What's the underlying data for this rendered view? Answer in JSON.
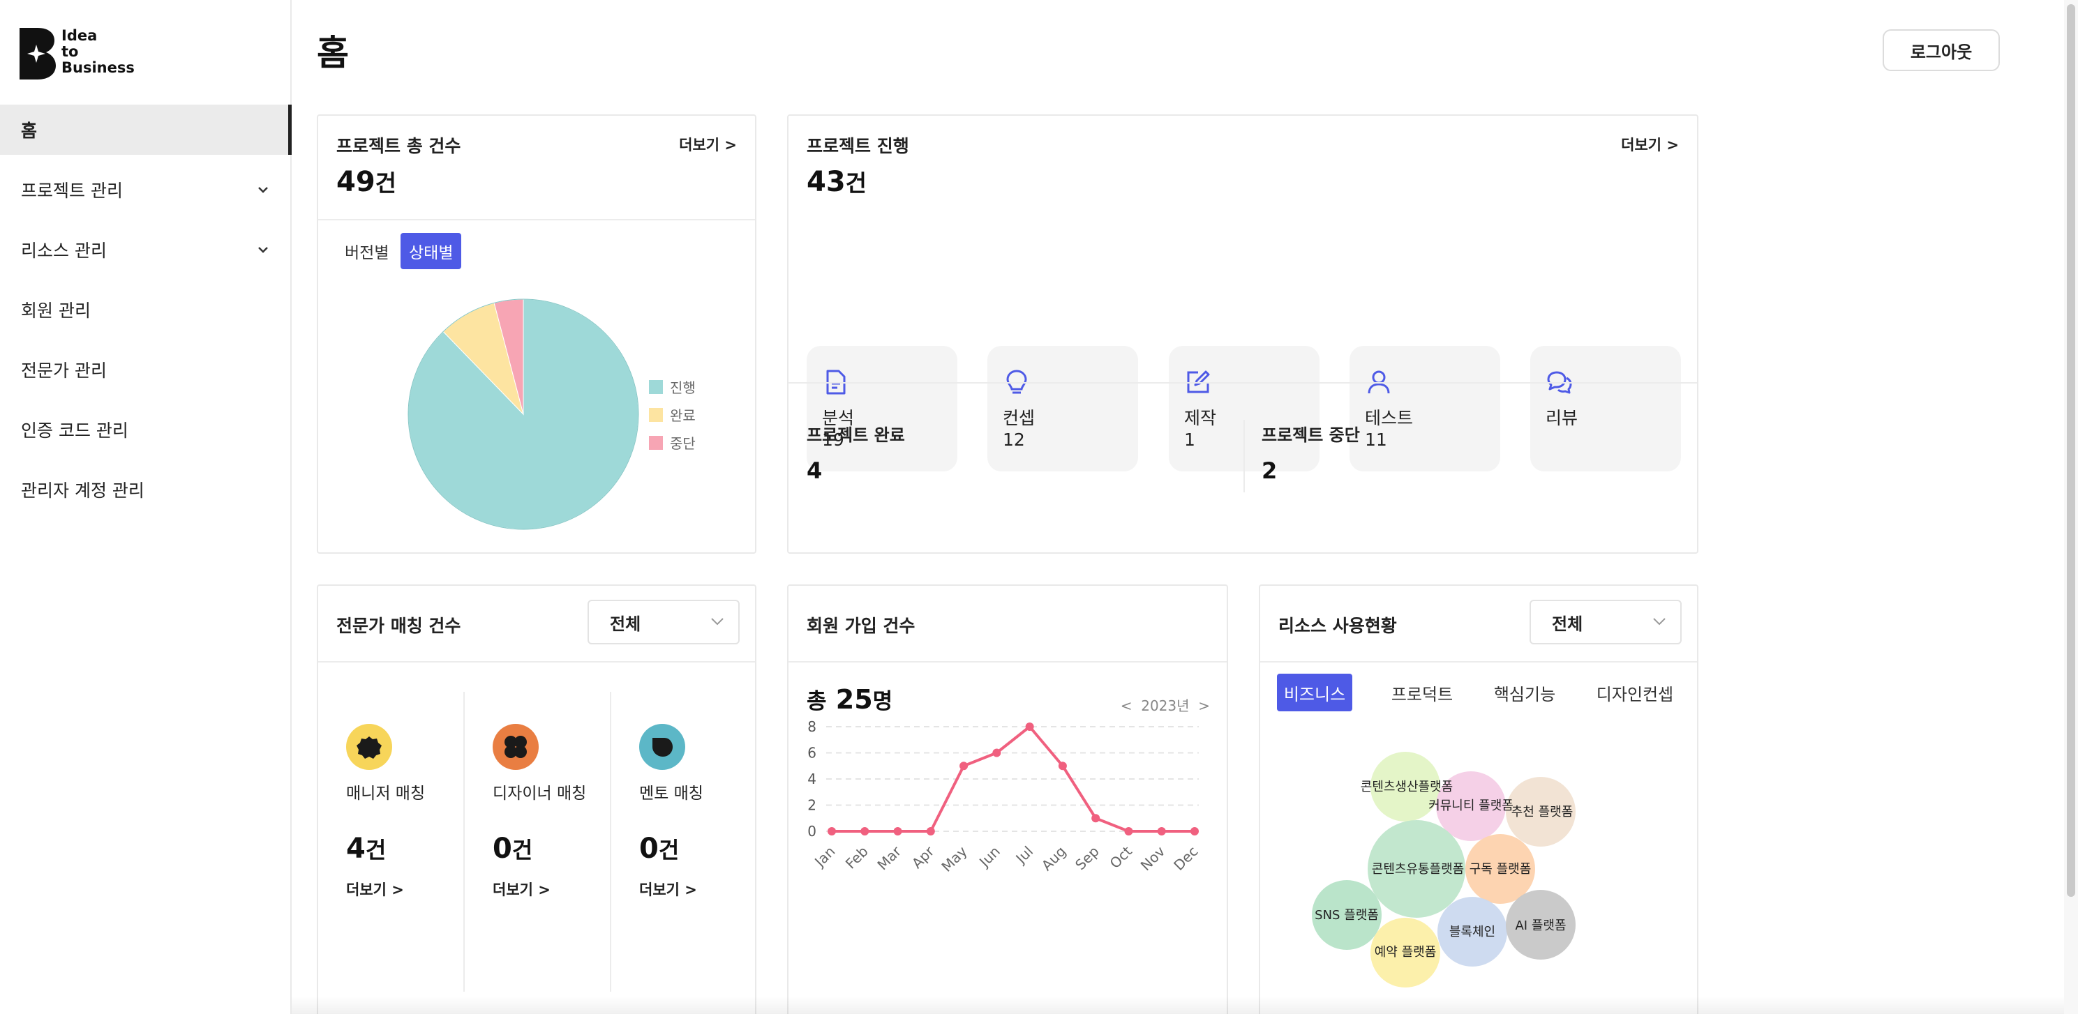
{
  "brand": {
    "line1": "Idea",
    "line2": "to",
    "line3": "Business"
  },
  "sidebar": {
    "items": [
      {
        "label": "홈",
        "active": true,
        "expandable": false
      },
      {
        "label": "프로젝트 관리",
        "expandable": true
      },
      {
        "label": "리소스 관리",
        "expandable": true
      },
      {
        "label": "회원 관리",
        "expandable": false
      },
      {
        "label": "전문가 관리",
        "expandable": false
      },
      {
        "label": "인증 코드 관리",
        "expandable": false
      },
      {
        "label": "관리자 계정 관리",
        "expandable": false
      }
    ]
  },
  "header": {
    "title": "홈",
    "logout_label": "로그아웃"
  },
  "total_projects": {
    "title": "프로젝트 총 건수",
    "more": "더보기 >",
    "count": "49",
    "unit": "건",
    "tabs": [
      {
        "label": "버전별",
        "active": false
      },
      {
        "label": "상태별",
        "active": true
      }
    ],
    "chart_data": {
      "type": "pie",
      "labels": [
        "진행",
        "완료",
        "중단"
      ],
      "values": [
        43,
        4,
        2
      ],
      "colors": [
        "#9ed9d8",
        "#fde4a1",
        "#f7a5b4"
      ],
      "legend": "right"
    }
  },
  "project_progress": {
    "title": "프로젝트 진행",
    "more": "더보기 >",
    "count": "43",
    "unit": "건",
    "stages": [
      {
        "label": "분석",
        "value": "19",
        "icon": "document-icon"
      },
      {
        "label": "컨셉",
        "value": "12",
        "icon": "lightbulb-icon"
      },
      {
        "label": "제작",
        "value": "1",
        "icon": "edit-icon"
      },
      {
        "label": "테스트",
        "value": "11",
        "icon": "user-icon"
      },
      {
        "label": "리뷰",
        "value": "",
        "icon": "chat-bubbles-icon"
      }
    ],
    "complete": {
      "label": "프로젝트 완료",
      "value": "4"
    },
    "stopped": {
      "label": "프로젝트 중단",
      "value": "2"
    }
  },
  "expert_matching": {
    "title": "전문가 매칭 건수",
    "filter": "전체",
    "items": [
      {
        "label": "매니저 매칭",
        "count": "4",
        "unit": "건",
        "more": "더보기 >",
        "color": "#f7d55a"
      },
      {
        "label": "디자이너 매칭",
        "count": "0",
        "unit": "건",
        "more": "더보기 >",
        "color": "#e97e42"
      },
      {
        "label": "멘토 매칭",
        "count": "0",
        "unit": "건",
        "more": "더보기 >",
        "color": "#5cb7c7"
      }
    ]
  },
  "signups": {
    "title": "회원 가입 건수",
    "total_prefix": "총",
    "total": "25",
    "unit": "명",
    "year_nav": "<  2023년  >",
    "chart_data": {
      "type": "line",
      "x": [
        "Jan",
        "Feb",
        "Mar",
        "Apr",
        "May",
        "Jun",
        "Jul",
        "Aug",
        "Sep",
        "Oct",
        "Nov",
        "Dec"
      ],
      "y": [
        0,
        0,
        0,
        0,
        5,
        6,
        8,
        5,
        1,
        0,
        0,
        0
      ],
      "ylim": [
        0,
        8
      ],
      "yticks": [
        0,
        2,
        4,
        6,
        8
      ],
      "grid": true,
      "color": "#f0607f"
    }
  },
  "resources": {
    "title": "리소스 사용현황",
    "filter": "전체",
    "tabs": [
      {
        "label": "비즈니스",
        "active": true
      },
      {
        "label": "프로덕트",
        "active": false
      },
      {
        "label": "핵심기능",
        "active": false
      },
      {
        "label": "디자인컨셉",
        "active": false
      }
    ],
    "bubbles": [
      {
        "label": "콘텐츠생산플랫폼",
        "color": "#e3f4c5"
      },
      {
        "label": "커뮤니티 플랫폼",
        "color": "#f4cde6"
      },
      {
        "label": "추천 플랫폼",
        "color": "#f1e2d2"
      },
      {
        "label": "콘텐츠유통플랫폼",
        "color": "#bfe6cb"
      },
      {
        "label": "구독 플랫폼",
        "color": "#fdd2ad"
      },
      {
        "label": "SNS 플랫폼",
        "color": "#b6e3c7"
      },
      {
        "label": "블록체인",
        "color": "#cbd9ef"
      },
      {
        "label": "AI 플랫폼",
        "color": "#c7c7c7"
      },
      {
        "label": "예약 플랫폼",
        "color": "#fcefa7"
      }
    ]
  }
}
